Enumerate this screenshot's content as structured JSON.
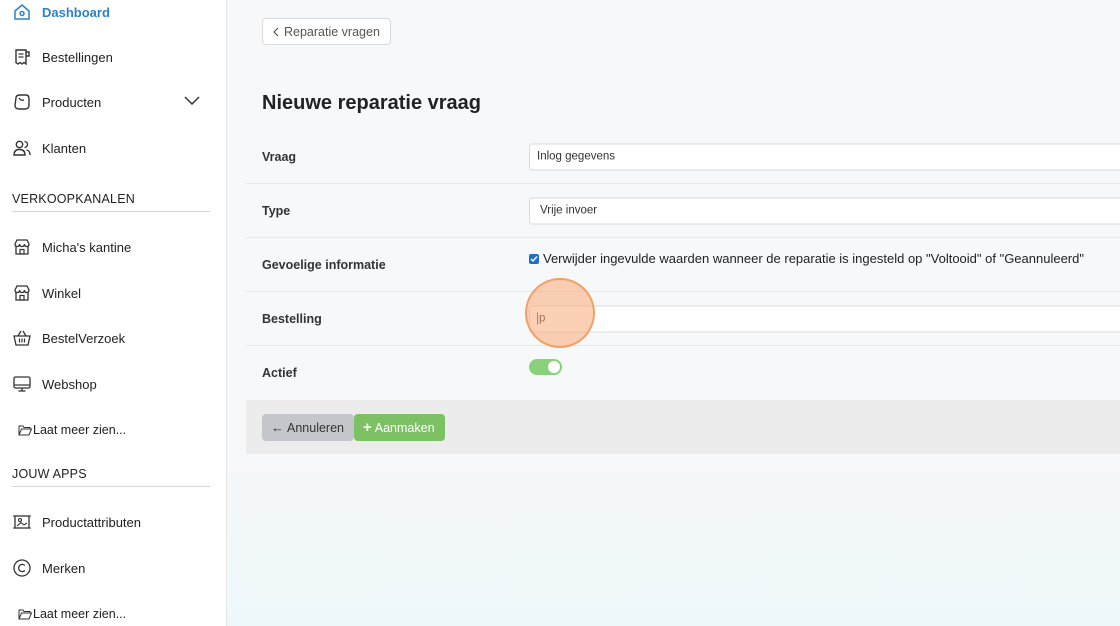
{
  "sidebar": {
    "items": [
      {
        "label": "Dashboard",
        "icon": "home-icon"
      },
      {
        "label": "Bestellingen",
        "icon": "receipt-icon"
      },
      {
        "label": "Producten",
        "icon": "box-icon"
      },
      {
        "label": "Klanten",
        "icon": "users-icon"
      }
    ],
    "sections": {
      "sales_channels": {
        "title": "VERKOOPKANALEN",
        "items": [
          {
            "label": "Micha's kantine",
            "icon": "store-icon"
          },
          {
            "label": "Winkel",
            "icon": "store-icon"
          },
          {
            "label": "BestelVerzoek",
            "icon": "basket-icon"
          },
          {
            "label": "Webshop",
            "icon": "monitor-icon"
          }
        ],
        "more": "Laat meer zien..."
      },
      "apps": {
        "title": "JOUW APPS",
        "items": [
          {
            "label": "Productattributen",
            "icon": "attributes-icon"
          },
          {
            "label": "Merken",
            "icon": "copyright-icon"
          }
        ],
        "more": "Laat meer zien..."
      }
    }
  },
  "main": {
    "back_label": "Reparatie vragen",
    "title": "Nieuwe reparatie vraag",
    "form": {
      "vraag": {
        "label": "Vraag",
        "value": "Inlog gegevens"
      },
      "type": {
        "label": "Type",
        "value": "Vrije invoer"
      },
      "gevoelig": {
        "label": "Gevoelige informatie",
        "checkbox_label": "Verwijder ingevulde waarden wanneer de reparatie is ingesteld op \"Voltooid\" of \"Geannuleerd\"",
        "checked": true
      },
      "bestelling": {
        "label": "Bestelling",
        "value": "p"
      },
      "actief": {
        "label": "Actief",
        "on": true
      }
    },
    "buttons": {
      "cancel": "Annuleren",
      "create": "Aanmaken"
    }
  },
  "colors": {
    "accent": "#2a84c7",
    "toggle_on": "#8ad27a",
    "create_button": "#7cc164",
    "cancel_button": "#c3c7cb"
  }
}
